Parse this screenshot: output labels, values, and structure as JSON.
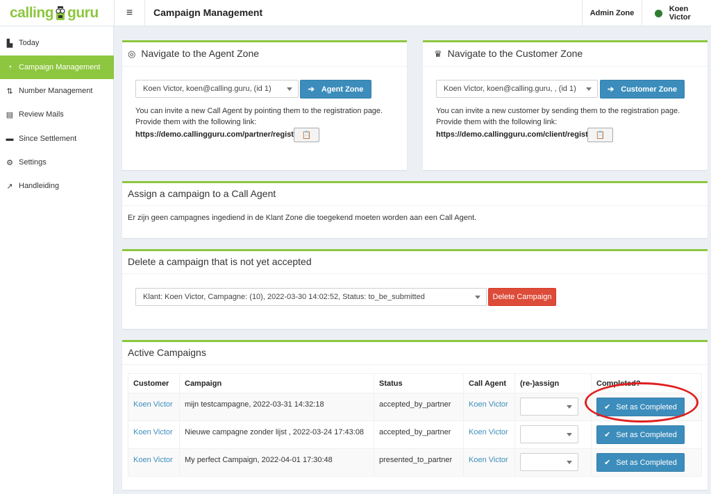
{
  "logo": {
    "part1": "calling",
    "part2": "guru"
  },
  "header": {
    "title": "Campaign Management",
    "admin_zone": "Admin Zone",
    "user_name": "Koen Victor",
    "menu_icon": "≡"
  },
  "sidebar": {
    "items": [
      {
        "label": "Today",
        "icon": "bar-chart-icon",
        "glyph": "▙"
      },
      {
        "label": "Campaign Management",
        "icon": "headset-icon",
        "glyph": "◔"
      },
      {
        "label": "Number Management",
        "icon": "sort-icon",
        "glyph": "⇅"
      },
      {
        "label": "Review Mails",
        "icon": "list-icon",
        "glyph": "▤"
      },
      {
        "label": "Since Settlement",
        "icon": "card-icon",
        "glyph": "▬"
      },
      {
        "label": "Settings",
        "icon": "gears-icon",
        "glyph": "⚙"
      },
      {
        "label": "Handleiding",
        "icon": "external-link-icon",
        "glyph": "↗"
      }
    ]
  },
  "agent_zone": {
    "title": "Navigate to the Agent Zone",
    "select_value": "Koen Victor, koen@calling.guru, (id 1)",
    "button": "Agent Zone",
    "line1": "You can invite a new Call Agent by pointing them to the registration page.",
    "line2": "Provide them with the following link:",
    "link": "https://demo.callingguru.com/partner/register"
  },
  "customer_zone": {
    "title": "Navigate to the Customer Zone",
    "select_value": "Koen Victor, koen@calling.guru, , (id 1)",
    "button": "Customer Zone",
    "line1": "You can invite a new customer by sending them to the registration page.",
    "line2": "Provide them with the following link:",
    "link": "https://demo.callingguru.com/client/register"
  },
  "assign": {
    "title": "Assign a campaign to a Call Agent",
    "message": "Er zijn geen campagnes ingediend in de Klant Zone die toegekend moeten worden aan een Call Agent."
  },
  "delete": {
    "title": "Delete a campaign that is not yet accepted",
    "select_value": "Klant: Koen Victor, Campagne: (10), 2022-03-30 14:02:52, Status: to_be_submitted",
    "button": "Delete Campaign"
  },
  "active": {
    "title": "Active Campaigns",
    "headers": [
      "Customer",
      "Campaign",
      "Status",
      "Call Agent",
      "(re-)assign",
      "Completed?"
    ],
    "button_label": "Set as Completed",
    "rows": [
      {
        "customer": "Koen Victor",
        "campaign": "mijn testcampagne, 2022-03-31 14:32:18",
        "status": "accepted_by_partner",
        "agent": "Koen Victor"
      },
      {
        "customer": "Koen Victor",
        "campaign": "Nieuwe campagne zonder lijst , 2022-03-24 17:43:08",
        "status": "accepted_by_partner",
        "agent": "Koen Victor"
      },
      {
        "customer": "Koen Victor",
        "campaign": "My perfect Campaign, 2022-04-01 17:30:48",
        "status": "presented_to_partner",
        "agent": "Koen Victor"
      }
    ]
  },
  "colors": {
    "brand": "#8dc63f",
    "primary": "#3c8dbc",
    "danger": "#dd4b39",
    "highlight": "#e02020"
  }
}
